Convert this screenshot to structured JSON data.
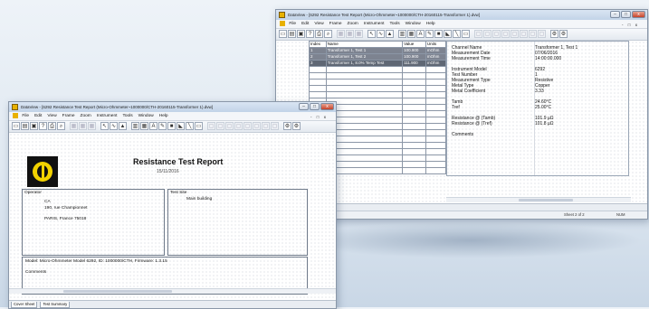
{
  "back_window": {
    "title": "DataView - [6292 Resistance Test Report (Micro-Ohmmeter~1000000/CTH-20160115-Transformer 1).dvw]",
    "menu": [
      "File",
      "Edit",
      "View",
      "Frame",
      "Zoom",
      "Instrument",
      "Tools",
      "Window",
      "Help"
    ],
    "table_headers": [
      "Index",
      "Name",
      "Value",
      "Units"
    ],
    "table_rows": [
      {
        "index": "1",
        "name": "Transformer 1, Test 1",
        "value": "100.900",
        "units": "mOhm"
      },
      {
        "index": "2",
        "name": "Transformer 1, Test 2",
        "value": "100.900",
        "units": "mOhm"
      },
      {
        "index": "3",
        "name": "Transformer 1, 8.0% Temp Test",
        "value": "111.900",
        "units": "mOhm"
      }
    ],
    "details": [
      {
        "k": "Channel Name",
        "v": "Transformer 1, Test 1"
      },
      {
        "k": "Measurement Date",
        "v": "07/06/2016"
      },
      {
        "k": "Measurement Time",
        "v": "14:00:00.000"
      },
      {
        "k": "Instrument Model",
        "v": "6292"
      },
      {
        "k": "Test Number",
        "v": "1"
      },
      {
        "k": "Measurement Type",
        "v": "Resistive"
      },
      {
        "k": "Metal Type",
        "v": "Copper"
      },
      {
        "k": "Metal Coefficient",
        "v": "3.33"
      },
      {
        "k": "Tamb",
        "v": "24.60°C"
      },
      {
        "k": "Tref",
        "v": "25.00°C"
      },
      {
        "k": "Resistance @ (Tamb)",
        "v": "101.9 µΩ"
      },
      {
        "k": "Resistance @ (Tref)",
        "v": "101.8 µΩ"
      },
      {
        "k": "Comments",
        "v": ""
      }
    ],
    "sheet_tab": "ary",
    "status_sheet": "Sheet 2 of 2",
    "status_mode": "NUM"
  },
  "front_window": {
    "title": "DataView - [6292 Resistance Test Report (Micro-Ohmmeter~1000000/CTH-20160115-Transformer 1).dvw]",
    "menu": [
      "File",
      "Edit",
      "View",
      "Frame",
      "Zoom",
      "Instrument",
      "Tools",
      "Window",
      "Help"
    ],
    "report_title": "Resistance Test Report",
    "report_date": "15/11/2016",
    "operator_label": "Operator",
    "operator_lines": [
      "CA",
      "190, rue Championnet",
      "PARIS, France 75018"
    ],
    "test_site_label": "Test Site",
    "test_site_value": "Main building",
    "model_line": "Model: Micro-Ohmmeter Model 6292, ID: 1000000/CTH, Firmware: 1.3.15",
    "comments_label": "Comments",
    "sheet_tabs": [
      "Cover Sheet",
      "Test Summary"
    ]
  }
}
